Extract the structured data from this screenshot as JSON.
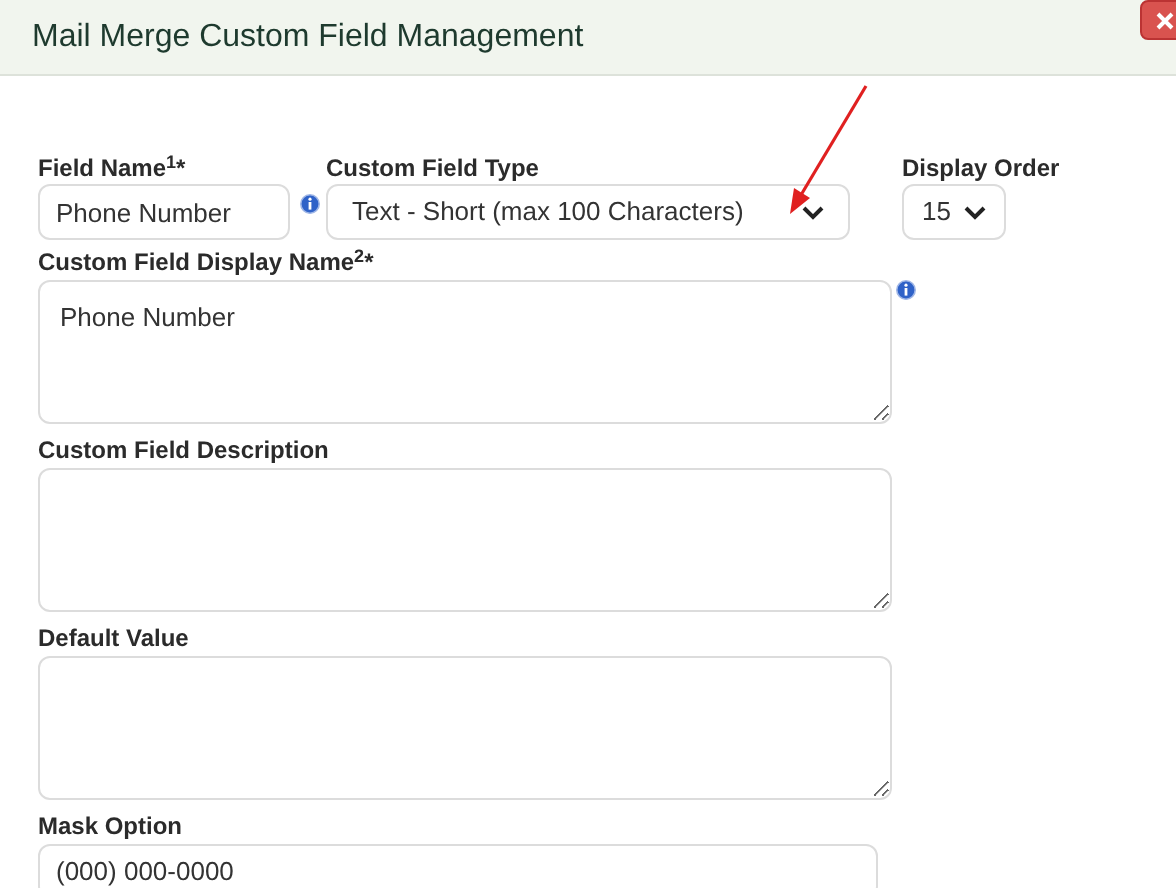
{
  "window": {
    "title": "Mail Merge Custom Field Management"
  },
  "fields": {
    "field_name": {
      "label": "Field Name$^{1}$*",
      "value": "Phone Number"
    },
    "custom_field_type": {
      "label": "Custom Field Type",
      "value": "Text - Short (max 100 Characters)"
    },
    "display_order": {
      "label": "Display Order",
      "value": "15"
    },
    "display_name": {
      "label": "Custom Field Display Name$^{2}$*",
      "value": "Phone Number"
    },
    "description": {
      "label": "Custom Field Description"
    },
    "default_value": {
      "label": "Default Value"
    },
    "mask_option": {
      "label": "Mask Option",
      "value": "(000) 000-0000"
    }
  }
}
